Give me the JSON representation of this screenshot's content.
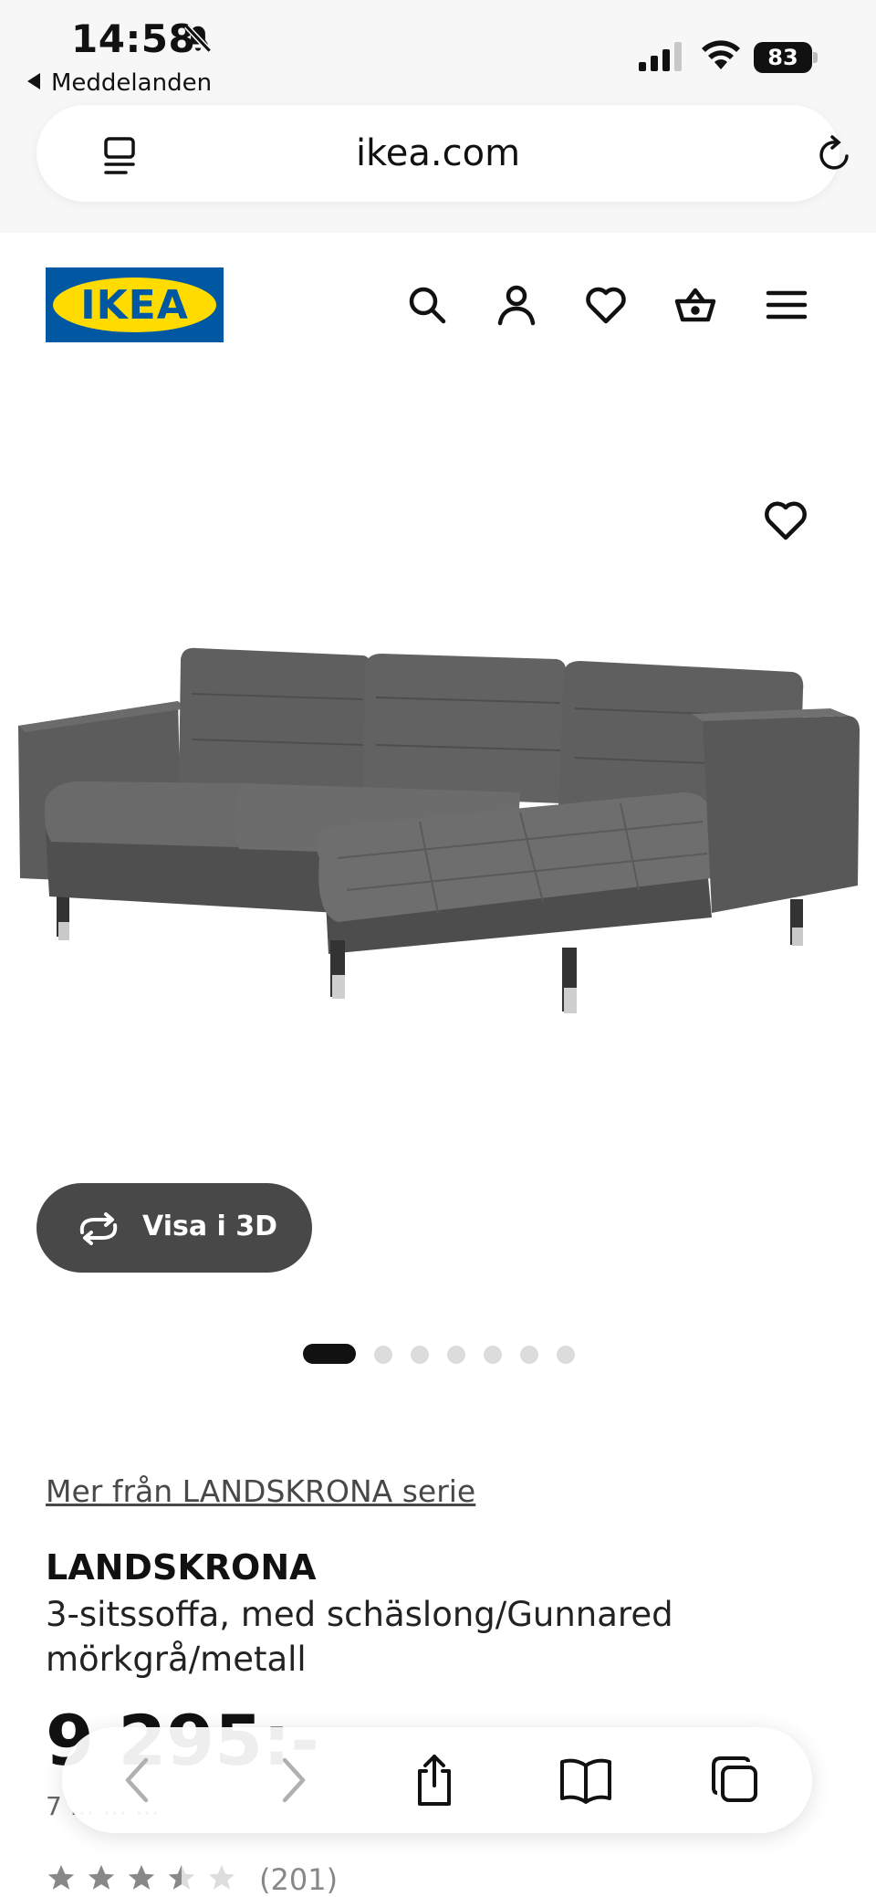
{
  "status_bar": {
    "time": "14:58",
    "back_app": "Meddelanden",
    "battery": "83"
  },
  "browser": {
    "url": "ikea.com"
  },
  "header": {
    "logo_text": "IKEA",
    "icons": [
      "search-icon",
      "account-icon",
      "favorites-icon",
      "cart-icon",
      "menu-icon"
    ]
  },
  "gallery": {
    "view_3d_label": "Visa i 3D",
    "image_count": 7,
    "active_index": 0
  },
  "product": {
    "series_link": "Mer från LANDSKRONA serie",
    "name": "LANDSKRONA",
    "description": "3-sitssoffa, med schäslong/Gunnared mörkgrå/metall",
    "price": "9 295:-",
    "price_sub": "7 ... ... ...",
    "rating_stars": 3.5,
    "review_count": "(201)"
  },
  "colors": {
    "ikea_blue": "#0058a3",
    "ikea_yellow": "#ffdb00",
    "button_dark": "#484848"
  }
}
